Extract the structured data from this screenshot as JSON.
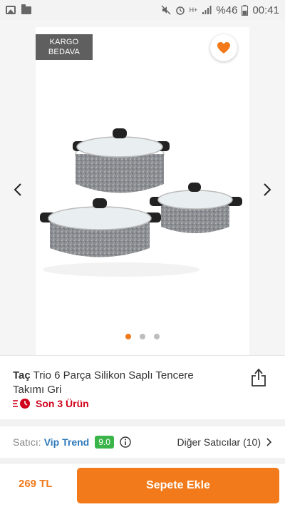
{
  "status_bar": {
    "signal_text": "H+",
    "battery": "%46",
    "time": "00:41"
  },
  "badge": {
    "line1": "KARGO",
    "line2": "BEDAVA"
  },
  "carousel": {
    "total_images": 3,
    "active_index": 0
  },
  "product": {
    "brand": "Taç",
    "name": "Trio 6 Parça Silikon Saplı Tencere Takımı Gri",
    "stock_text": "Son 3 Ürün"
  },
  "seller": {
    "label": "Satıcı:",
    "name": "Vip Trend",
    "score": "9.0",
    "other_sellers": "Diğer Satıcılar (10)"
  },
  "purchase": {
    "price": "269 TL",
    "add_to_cart": "Sepete Ekle"
  },
  "colors": {
    "accent": "#f27a1a",
    "stock_red": "#d0021b",
    "seller_blue": "#2e79b9",
    "score_green": "#3bb54a"
  },
  "icons": {
    "status_left": [
      "image-icon",
      "folder-icon"
    ],
    "status_right": [
      "mute-icon",
      "alarm-icon",
      "signal-icon",
      "battery-icon"
    ],
    "favorite": "heart-icon",
    "share": "share-icon",
    "stock": "clock-icon",
    "info": "info-icon",
    "nav": [
      "chevron-left-icon",
      "chevron-right-icon"
    ]
  }
}
